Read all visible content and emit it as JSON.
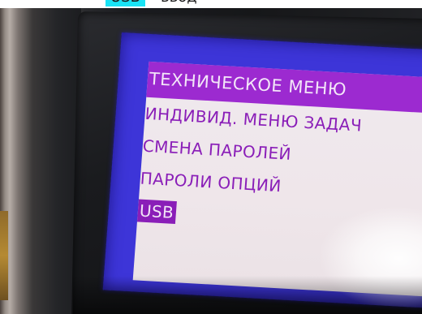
{
  "caption": {
    "highlight": "USB",
    "text": "ввод"
  },
  "screen": {
    "title": "ТЕХНИЧЕСКОЕ МЕНЮ",
    "items": [
      "ИНДИВИД. МЕНЮ ЗАДАЧ",
      "СМЕНА ПАРОЛЕЙ",
      "ПАРОЛИ ОПЦИЙ"
    ],
    "selected_item": "USB"
  },
  "colors": {
    "screen_border": "#3d35d8",
    "title_bar": "#9c2ad0",
    "menu_text": "#8a1eb8",
    "caption_highlight": "#19e3f5"
  }
}
